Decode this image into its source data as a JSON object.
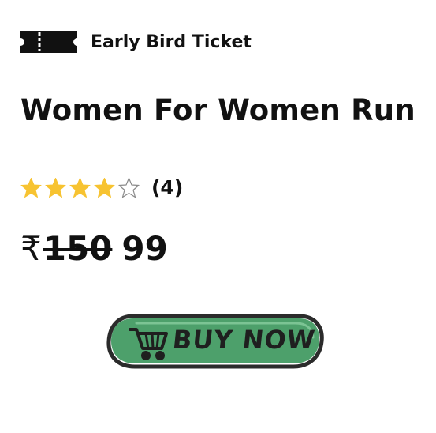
{
  "badge": {
    "icon": "ticket-icon",
    "label": "Early Bird Ticket"
  },
  "event": {
    "title": "Women For Women Run"
  },
  "rating": {
    "stars_filled": 4,
    "stars_total": 5,
    "count_text": "(4)",
    "star_color": "#F7C331"
  },
  "price": {
    "currency_symbol": "₹",
    "original": "150",
    "current": "99"
  },
  "cta": {
    "label": "BUY NOW",
    "icon": "shopping-cart-icon",
    "fill_color": "#4DA06B",
    "outline_color": "#2B2B2B"
  }
}
